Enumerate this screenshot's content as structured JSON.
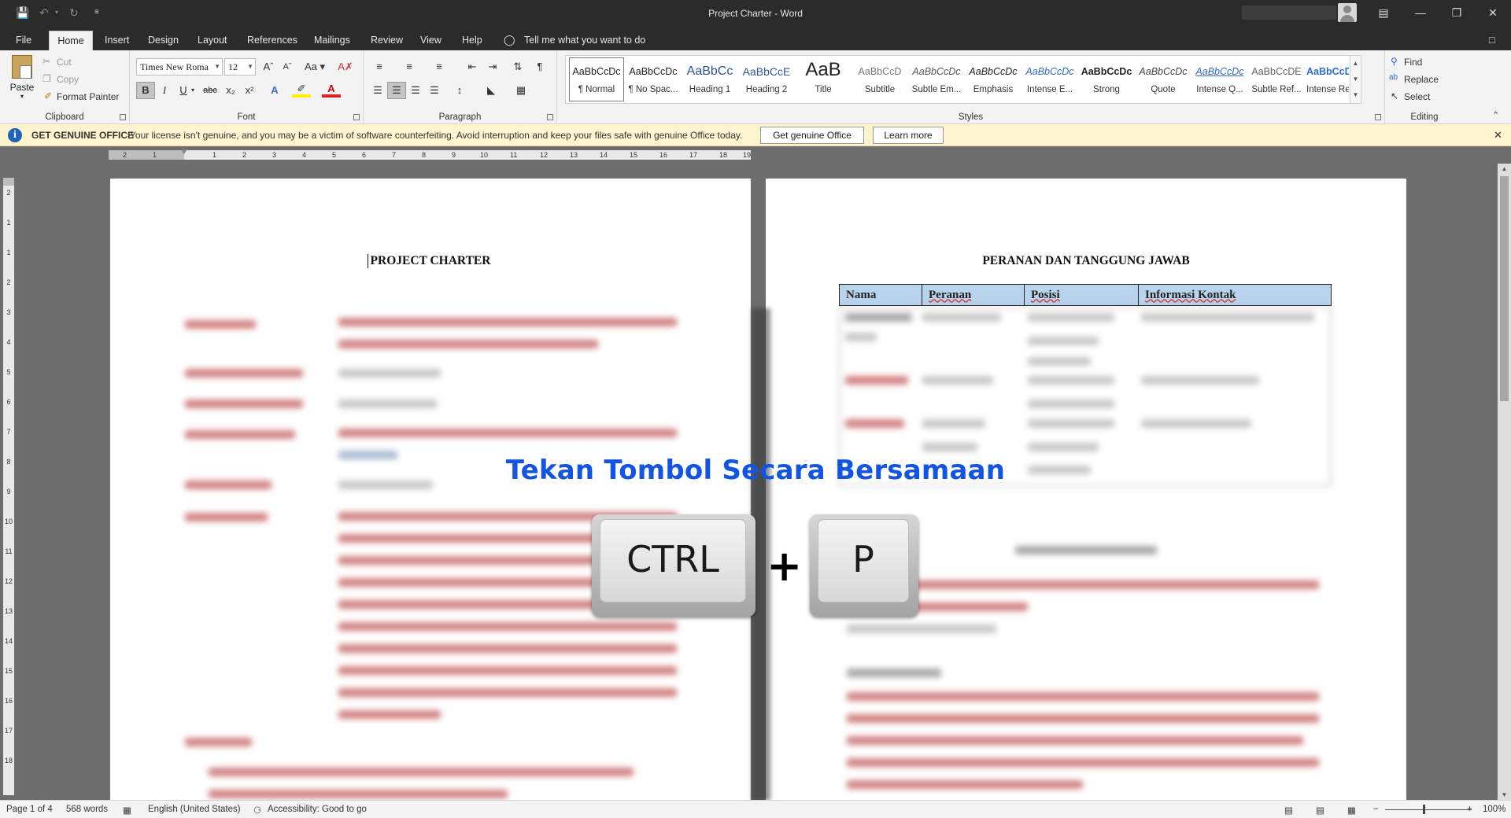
{
  "window": {
    "title": "Project Charter  -  Word"
  },
  "menu_tabs": [
    "File",
    "Home",
    "Insert",
    "Design",
    "Layout",
    "References",
    "Mailings",
    "Review",
    "View",
    "Help"
  ],
  "tell_me": "Tell me what you want to do",
  "clipboard": {
    "paste": "Paste",
    "cut": "Cut",
    "copy": "Copy",
    "format_painter": "Format Painter",
    "label": "Clipboard"
  },
  "font": {
    "name": "Times New Roma",
    "size": "12",
    "change_case": "Aa",
    "label": "Font"
  },
  "paragraph": {
    "label": "Paragraph"
  },
  "styles": {
    "label": "Styles",
    "items": [
      {
        "preview": "AaBbCcDc",
        "name": "¶ Normal"
      },
      {
        "preview": "AaBbCcDc",
        "name": "¶ No Spac..."
      },
      {
        "preview": "AaBbCc",
        "name": "Heading 1"
      },
      {
        "preview": "AaBbCcE",
        "name": "Heading 2"
      },
      {
        "preview": "AaB",
        "name": "Title"
      },
      {
        "preview": "AaBbCcD",
        "name": "Subtitle"
      },
      {
        "preview": "AaBbCcDc",
        "name": "Subtle Em..."
      },
      {
        "preview": "AaBbCcDc",
        "name": "Emphasis"
      },
      {
        "preview": "AaBbCcDc",
        "name": "Intense E..."
      },
      {
        "preview": "AaBbCcDc",
        "name": "Strong"
      },
      {
        "preview": "AaBbCcDc",
        "name": "Quote"
      },
      {
        "preview": "AaBbCcDc",
        "name": "Intense Q..."
      },
      {
        "preview": "AaBbCcDE",
        "name": "Subtle Ref..."
      },
      {
        "preview": "AaBbCcDE",
        "name": "Intense Re..."
      }
    ]
  },
  "editing": {
    "find": "Find",
    "replace": "Replace",
    "select": "Select",
    "label": "Editing"
  },
  "notice": {
    "title": "GET GENUINE OFFICE",
    "message": "Your license isn't genuine, and you may be a victim of software counterfeiting. Avoid interruption and keep your files safe with genuine Office today.",
    "primary": "Get genuine Office",
    "secondary": "Learn more"
  },
  "ruler_labels": [
    "2",
    "1",
    "1",
    "2",
    "3",
    "4",
    "5",
    "6",
    "7",
    "8",
    "9",
    "10",
    "11",
    "12",
    "13",
    "14",
    "15",
    "16",
    "17",
    "18",
    "19"
  ],
  "vruler_labels": [
    "2",
    "1",
    "1",
    "2",
    "3",
    "4",
    "5",
    "6",
    "7",
    "8",
    "9",
    "10",
    "11",
    "12",
    "13",
    "14",
    "15",
    "16",
    "17",
    "18"
  ],
  "document": {
    "left_heading": "PROJECT CHARTER",
    "right_heading": "PERANAN DAN TANGGUNG JAWAB",
    "table_headers": [
      "Nama",
      "Peranan",
      "Posisi",
      "Informasi Kontak"
    ]
  },
  "overlay": {
    "caption": "Tekan Tombol Secara Bersamaan",
    "key1": "CTRL",
    "plus": "+",
    "key2": "P"
  },
  "status": {
    "page": "Page 1 of 4",
    "words": "568 words",
    "language": "English (United States)",
    "accessibility": "Accessibility: Good to go",
    "zoom": "100%"
  }
}
